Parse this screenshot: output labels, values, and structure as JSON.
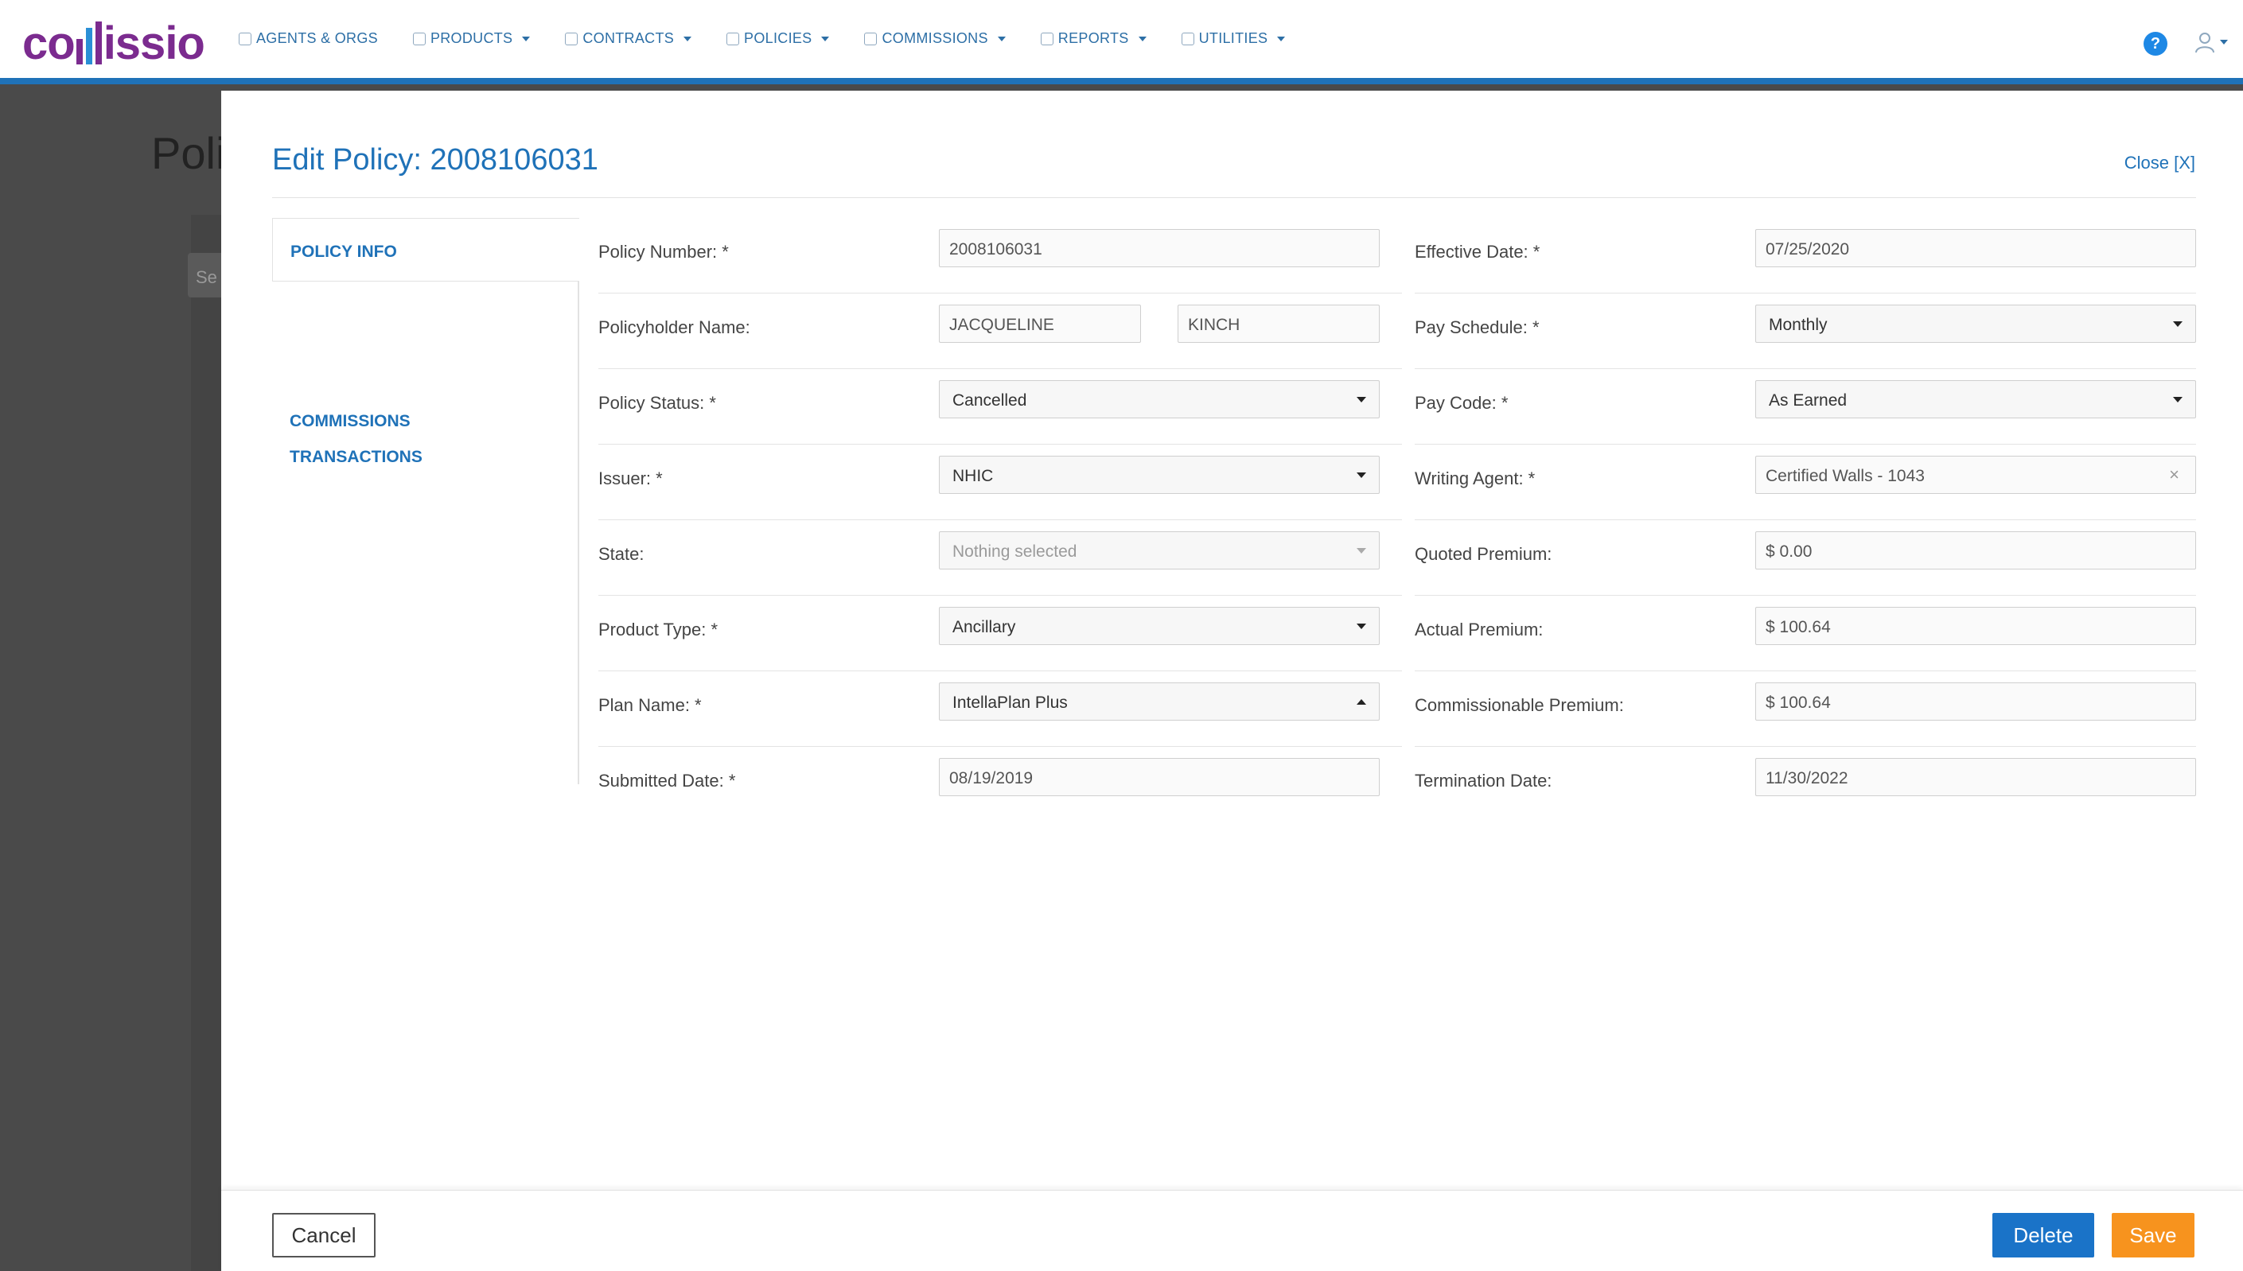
{
  "app": {
    "logo_text_left": "co",
    "logo_text_right": "issio"
  },
  "nav": [
    {
      "label": "AGENTS & ORGS",
      "dropdown": false
    },
    {
      "label": "PRODUCTS",
      "dropdown": true
    },
    {
      "label": "CONTRACTS",
      "dropdown": true
    },
    {
      "label": "POLICIES",
      "dropdown": true
    },
    {
      "label": "COMMISSIONS",
      "dropdown": true
    },
    {
      "label": "REPORTS",
      "dropdown": true
    },
    {
      "label": "UTILITIES",
      "dropdown": true
    }
  ],
  "help_label": "?",
  "background": {
    "title": "Poli",
    "search_placeholder": "Se"
  },
  "modal": {
    "title": "Edit Policy: 2008106031",
    "close_label": "Close [X]",
    "tabs": {
      "active": "POLICY INFO",
      "links": [
        "COMMISSIONS",
        "TRANSACTIONS"
      ]
    },
    "left": {
      "policy_number": {
        "label": "Policy Number: *",
        "value": "2008106031"
      },
      "policyholder": {
        "label": "Policyholder Name:",
        "first": "JACQUELINE",
        "last": "KINCH"
      },
      "policy_status": {
        "label": "Policy Status: *",
        "value": "Cancelled"
      },
      "issuer": {
        "label": "Issuer: *",
        "value": "NHIC"
      },
      "state": {
        "label": "State:",
        "value": "Nothing selected"
      },
      "product_type": {
        "label": "Product Type: *",
        "value": "Ancillary"
      },
      "plan_name": {
        "label": "Plan Name: *",
        "value": "IntellaPlan Plus"
      },
      "submitted_date": {
        "label": "Submitted Date: *",
        "value": "08/19/2019"
      }
    },
    "right": {
      "effective_date": {
        "label": "Effective Date: *",
        "value": "07/25/2020"
      },
      "pay_schedule": {
        "label": "Pay Schedule: *",
        "value": "Monthly"
      },
      "pay_code": {
        "label": "Pay Code: *",
        "value": "As Earned"
      },
      "writing_agent": {
        "label": "Writing Agent: *",
        "value": "Certified Walls - 1043",
        "clear": "×"
      },
      "quoted_premium": {
        "label": "Quoted Premium:",
        "value": "$ 0.00"
      },
      "actual_premium": {
        "label": "Actual Premium:",
        "value": "$ 100.64"
      },
      "commissionable_premium": {
        "label": "Commissionable Premium:",
        "value": "$ 100.64"
      },
      "termination_date": {
        "label": "Termination Date:",
        "value": "11/30/2022"
      }
    },
    "footer": {
      "cancel": "Cancel",
      "delete": "Delete",
      "save": "Save"
    }
  },
  "colors": {
    "brand_purple": "#7b2b8f",
    "link_blue": "#1f72b8",
    "delete_blue": "#1a73c8",
    "save_orange": "#f7931e"
  }
}
